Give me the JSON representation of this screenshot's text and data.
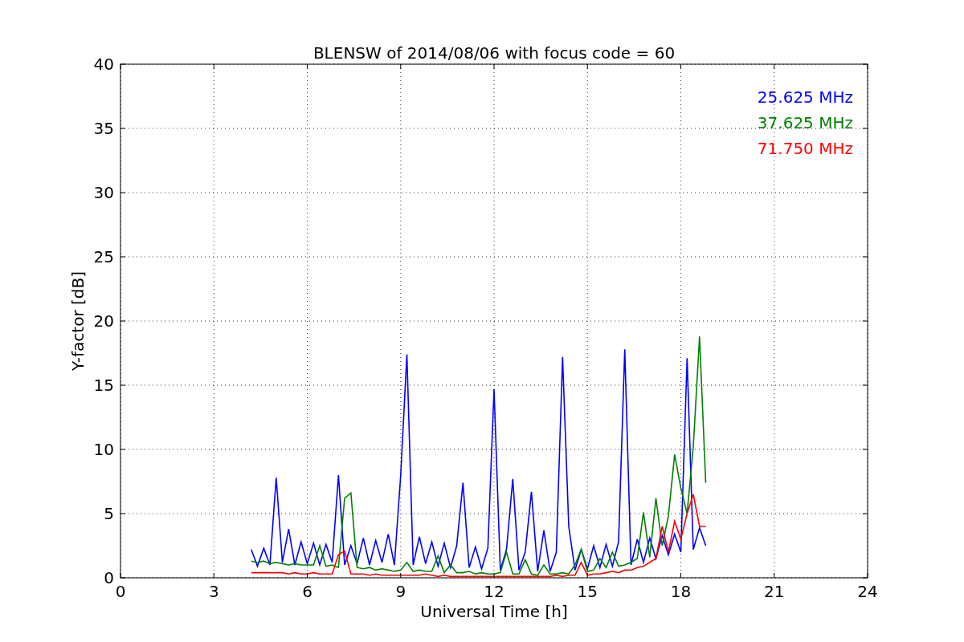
{
  "chart_data": {
    "type": "line",
    "title": "BLENSW of 2014/08/06 with focus code = 60",
    "xlabel": "Universal Time [h]",
    "ylabel": "Y-factor [dB]",
    "x": [
      4.2,
      4.4,
      4.6,
      4.8,
      5.0,
      5.2,
      5.4,
      5.6,
      5.8,
      6.0,
      6.2,
      6.4,
      6.6,
      6.8,
      7.0,
      7.2,
      7.4,
      7.6,
      7.8,
      8.0,
      8.2,
      8.4,
      8.6,
      8.8,
      9.0,
      9.2,
      9.4,
      9.6,
      9.8,
      10.0,
      10.2,
      10.4,
      10.6,
      10.8,
      11.0,
      11.2,
      11.4,
      11.6,
      11.8,
      12.0,
      12.2,
      12.4,
      12.6,
      12.8,
      13.0,
      13.2,
      13.4,
      13.6,
      13.8,
      14.0,
      14.2,
      14.4,
      14.6,
      14.8,
      15.0,
      15.2,
      15.4,
      15.6,
      15.8,
      16.0,
      16.2,
      16.4,
      16.6,
      16.8,
      17.0,
      17.2,
      17.4,
      17.6,
      17.8,
      18.0,
      18.2,
      18.4,
      18.6,
      18.8
    ],
    "series": [
      {
        "name": "25.625 MHz",
        "color": "#0000ff",
        "values": [
          2.2,
          0.9,
          2.3,
          1.0,
          7.8,
          1.2,
          3.8,
          1.0,
          2.8,
          1.1,
          2.7,
          1.0,
          2.6,
          1.2,
          8.0,
          1.0,
          2.5,
          1.1,
          3.1,
          1.0,
          2.9,
          1.2,
          3.4,
          1.0,
          8.0,
          17.4,
          1.0,
          3.2,
          1.1,
          2.8,
          0.9,
          2.7,
          0.8,
          2.5,
          7.4,
          0.8,
          2.4,
          0.7,
          2.3,
          14.7,
          0.6,
          2.2,
          7.7,
          0.6,
          2.0,
          6.7,
          0.5,
          3.7,
          0.5,
          2.0,
          17.2,
          4.0,
          0.6,
          2.2,
          0.7,
          2.5,
          0.8,
          2.6,
          0.9,
          2.8,
          17.8,
          1.0,
          3.0,
          1.2,
          3.1,
          1.5,
          3.3,
          1.8,
          3.4,
          2.0,
          17.1,
          2.2,
          3.9,
          2.5
        ]
      },
      {
        "name": "37.625 MHz",
        "color": "#008000",
        "values": [
          1.3,
          1.2,
          1.3,
          1.1,
          1.2,
          1.1,
          1.0,
          1.1,
          1.0,
          1.0,
          1.0,
          2.5,
          0.9,
          1.0,
          0.8,
          6.2,
          6.6,
          0.8,
          0.7,
          0.8,
          0.6,
          0.7,
          0.6,
          0.5,
          0.6,
          1.2,
          0.5,
          0.6,
          0.5,
          0.5,
          1.7,
          0.4,
          1.0,
          0.4,
          0.4,
          0.5,
          0.3,
          0.4,
          0.3,
          0.3,
          0.4,
          2.0,
          0.3,
          0.3,
          1.4,
          0.3,
          0.2,
          1.0,
          0.3,
          0.3,
          0.4,
          0.3,
          1.0,
          2.2,
          0.5,
          0.6,
          1.5,
          0.8,
          2.0,
          0.9,
          1.0,
          1.2,
          1.5,
          5.1,
          1.6,
          6.2,
          2.5,
          4.8,
          9.6,
          7.0,
          5.0,
          10.2,
          18.8,
          7.4
        ]
      },
      {
        "name": "71.750 MHz",
        "color": "#ff0000",
        "values": [
          0.4,
          0.4,
          0.4,
          0.4,
          0.4,
          0.4,
          0.3,
          0.4,
          0.3,
          0.3,
          0.4,
          0.3,
          0.3,
          0.3,
          1.8,
          2.1,
          0.3,
          0.3,
          0.3,
          0.2,
          0.3,
          0.2,
          0.2,
          0.2,
          0.2,
          0.2,
          0.2,
          0.2,
          0.3,
          0.2,
          0.1,
          0.2,
          0.1,
          0.1,
          0.1,
          0.1,
          0.1,
          0.1,
          0.1,
          0.1,
          0.1,
          0.1,
          0.1,
          0.1,
          0.1,
          0.1,
          0.1,
          0.1,
          0.1,
          0.2,
          0.1,
          0.2,
          0.2,
          1.2,
          0.2,
          0.3,
          0.3,
          0.4,
          0.5,
          0.4,
          0.6,
          0.6,
          0.8,
          0.9,
          1.2,
          1.5,
          4.0,
          2.0,
          4.4,
          3.0,
          5.0,
          6.5,
          4.0,
          4.0
        ]
      }
    ],
    "grid": true,
    "xlim": [
      0,
      24
    ],
    "ylim": [
      0,
      40
    ],
    "xticks": [
      0,
      3,
      6,
      9,
      12,
      15,
      18,
      21,
      24
    ],
    "yticks": [
      0,
      5,
      10,
      15,
      20,
      25,
      30,
      35,
      40
    ]
  }
}
